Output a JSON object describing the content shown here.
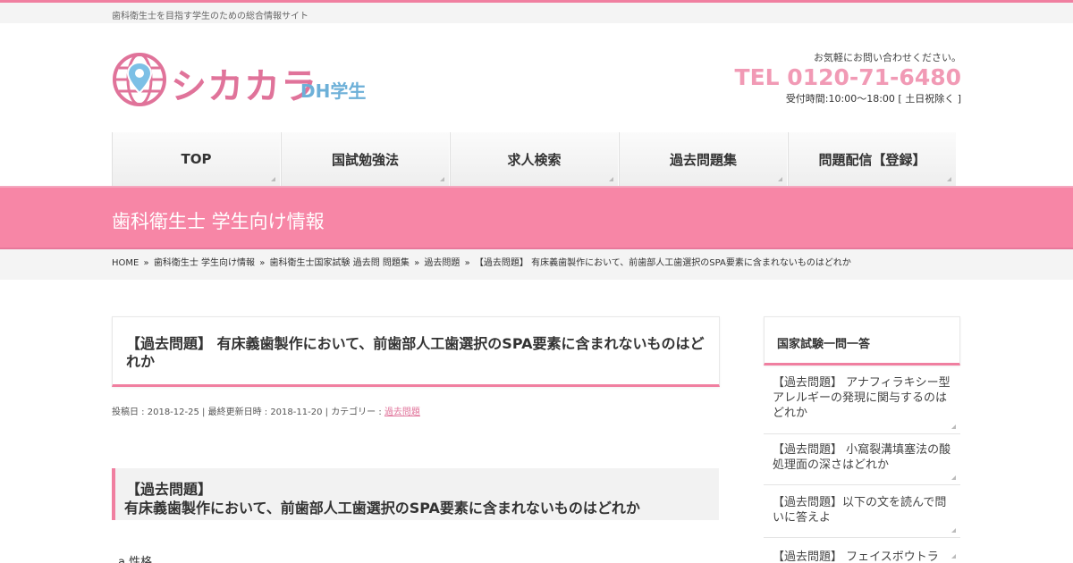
{
  "site": {
    "tagline": "歯科衛生士を目指す学生のための総合情報サイト",
    "logo_main": "シカカラ",
    "logo_sub": "DH学生"
  },
  "contact": {
    "note": "お気軽にお問い合わせください。",
    "tel": "TEL 0120-71-6480",
    "hours": "受付時間:10:00～18:00 [ 土日祝除く ]"
  },
  "nav": {
    "items": [
      {
        "label": "TOP"
      },
      {
        "label": "国試勉強法"
      },
      {
        "label": "求人検索"
      },
      {
        "label": "過去問題集"
      },
      {
        "label": "問題配信【登録】"
      }
    ]
  },
  "banner": {
    "title": "歯科衛生士 学生向け情報"
  },
  "breadcrumb": {
    "items": [
      {
        "label": "HOME"
      },
      {
        "label": "歯科衛生士 学生向け情報"
      },
      {
        "label": "歯科衛生士国家試験 過去問 問題集"
      },
      {
        "label": "過去問題"
      }
    ],
    "current": "【過去問題】 有床義歯製作において、前歯部人工歯選択のSPA要素に含まれないものはどれか",
    "separator": "»"
  },
  "post": {
    "title": "【過去問題】 有床義歯製作において、前歯部人工歯選択のSPA要素に含まれないものはどれか",
    "posted_label": "投稿日 : 2018-12-25",
    "updated_label": "最終更新日時 : 2018-11-20",
    "category_label": "カテゴリー :",
    "category": "過去問題",
    "section_line1": "【過去問題】",
    "section_line2": "有床義歯製作において、前歯部人工歯選択のSPA要素に含まれないものはどれか",
    "option_a": "a 性格"
  },
  "sidebar": {
    "heading": "国家試験一問一答",
    "items": [
      {
        "label": "【過去問題】 アナフィラキシー型アレルギーの発現に関与するのはどれか"
      },
      {
        "label": "【過去問題】 小窩裂溝填塞法の酸処理面の深さはどれか"
      },
      {
        "label": "【過去問題】以下の文を読んで問いに答えよ"
      },
      {
        "label": "【過去問題】 フェイスボウトラ"
      }
    ]
  },
  "colors": {
    "accent": "#f07fa0",
    "banner": "#f786a6",
    "tel": "#f19ab5",
    "logo_blue": "#6db0d8"
  }
}
